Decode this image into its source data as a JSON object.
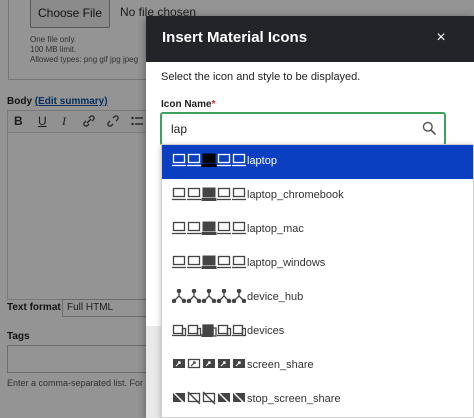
{
  "background": {
    "file": {
      "button_label": "Choose File",
      "status": "No file chosen"
    },
    "file_help": [
      "One file only.",
      "100 MB limit.",
      "Allowed types: png gif jpg jpeg"
    ],
    "body_label": "Body",
    "edit_summary_link": "(Edit summary)",
    "toolbar": {
      "bold": "B",
      "underline": "U",
      "italic": "I"
    },
    "text_format_label": "Text format",
    "text_format_value": "Full HTML",
    "tags_label": "Tags",
    "tags_help": "Enter a comma-separated list. For example: "
  },
  "modal": {
    "title": "Insert Material Icons",
    "close_label": "×",
    "description": "Select the icon and style to be displayed.",
    "field_label": "Icon Name",
    "required_mark": "*",
    "search_value": "lap"
  },
  "colors": {
    "header_bg": "#232429",
    "focus_border": "#3ba35b",
    "selected_bg": "#0a3fc2",
    "required": "#d4232a"
  },
  "dropdown": {
    "options": [
      {
        "label": "laptop",
        "icon": "laptop-icon",
        "selected": true
      },
      {
        "label": "laptop_chromebook",
        "icon": "laptop-chromebook-icon",
        "selected": false
      },
      {
        "label": "laptop_mac",
        "icon": "laptop-mac-icon",
        "selected": false
      },
      {
        "label": "laptop_windows",
        "icon": "laptop-windows-icon",
        "selected": false
      },
      {
        "label": "device_hub",
        "icon": "device-hub-icon",
        "selected": false
      },
      {
        "label": "devices",
        "icon": "devices-icon",
        "selected": false
      },
      {
        "label": "screen_share",
        "icon": "screen-share-icon",
        "selected": false
      },
      {
        "label": "stop_screen_share",
        "icon": "stop-screen-share-icon",
        "selected": false
      }
    ]
  }
}
